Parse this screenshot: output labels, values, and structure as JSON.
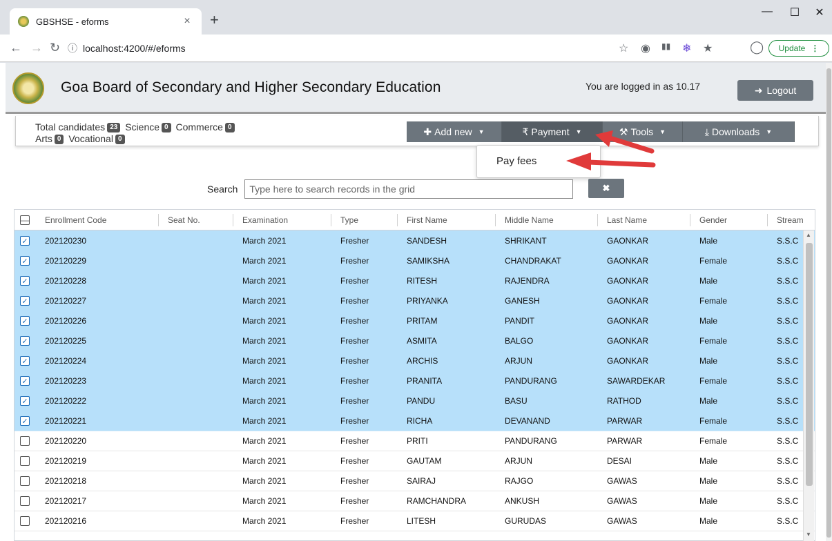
{
  "browser": {
    "tab_title": "GBSHSE - eforms",
    "tab_close": "×",
    "new_tab": "+",
    "url": "localhost:4200/#/eforms",
    "update_label": "Update"
  },
  "header": {
    "title": "Goa Board of Secondary and Higher Secondary Education",
    "logged_in_text": "You are logged in as 10.17",
    "logout_label": "Logout"
  },
  "counts": {
    "total_label": "Total candidates",
    "total": "23",
    "science_label": "Science",
    "science": "0",
    "commerce_label": "Commerce",
    "commerce": "0",
    "arts_label": "Arts",
    "arts": "0",
    "vocational_label": "Vocational",
    "vocational": "0"
  },
  "toolbar": {
    "add_new": "Add new",
    "payment": "Payment",
    "tools": "Tools",
    "downloads": "Downloads"
  },
  "dropdown": {
    "pay_fees": "Pay fees"
  },
  "search": {
    "label": "Search",
    "placeholder": "Type here to search records in the grid",
    "clear": "✖"
  },
  "grid": {
    "columns": [
      "Enrollment Code",
      "Seat No.",
      "Examination",
      "Type",
      "First Name",
      "Middle Name",
      "Last Name",
      "Gender",
      "Stream"
    ],
    "rows": [
      {
        "code": "202120230",
        "seat": "",
        "exam": "March 2021",
        "type": "Fresher",
        "first": "SANDESH",
        "middle": "SHRIKANT",
        "last": "GAONKAR",
        "gender": "Male",
        "stream": "S.S.C",
        "selected": true
      },
      {
        "code": "202120229",
        "seat": "",
        "exam": "March 2021",
        "type": "Fresher",
        "first": "SAMIKSHA",
        "middle": "CHANDRAKAT",
        "last": "GAONKAR",
        "gender": "Female",
        "stream": "S.S.C",
        "selected": true
      },
      {
        "code": "202120228",
        "seat": "",
        "exam": "March 2021",
        "type": "Fresher",
        "first": "RITESH",
        "middle": "RAJENDRA",
        "last": "GAONKAR",
        "gender": "Male",
        "stream": "S.S.C",
        "selected": true
      },
      {
        "code": "202120227",
        "seat": "",
        "exam": "March 2021",
        "type": "Fresher",
        "first": "PRIYANKA",
        "middle": "GANESH",
        "last": "GAONKAR",
        "gender": "Female",
        "stream": "S.S.C",
        "selected": true
      },
      {
        "code": "202120226",
        "seat": "",
        "exam": "March 2021",
        "type": "Fresher",
        "first": "PRITAM",
        "middle": "PANDIT",
        "last": "GAONKAR",
        "gender": "Male",
        "stream": "S.S.C",
        "selected": true
      },
      {
        "code": "202120225",
        "seat": "",
        "exam": "March 2021",
        "type": "Fresher",
        "first": "ASMITA",
        "middle": "BALGO",
        "last": "GAONKAR",
        "gender": "Female",
        "stream": "S.S.C",
        "selected": true
      },
      {
        "code": "202120224",
        "seat": "",
        "exam": "March 2021",
        "type": "Fresher",
        "first": "ARCHIS",
        "middle": "ARJUN",
        "last": "GAONKAR",
        "gender": "Male",
        "stream": "S.S.C",
        "selected": true
      },
      {
        "code": "202120223",
        "seat": "",
        "exam": "March 2021",
        "type": "Fresher",
        "first": "PRANITA",
        "middle": "PANDURANG",
        "last": "SAWARDEKAR",
        "gender": "Female",
        "stream": "S.S.C",
        "selected": true
      },
      {
        "code": "202120222",
        "seat": "",
        "exam": "March 2021",
        "type": "Fresher",
        "first": "PANDU",
        "middle": "BASU",
        "last": "RATHOD",
        "gender": "Male",
        "stream": "S.S.C",
        "selected": true
      },
      {
        "code": "202120221",
        "seat": "",
        "exam": "March 2021",
        "type": "Fresher",
        "first": "RICHA",
        "middle": "DEVANAND",
        "last": "PARWAR",
        "gender": "Female",
        "stream": "S.S.C",
        "selected": true
      },
      {
        "code": "202120220",
        "seat": "",
        "exam": "March 2021",
        "type": "Fresher",
        "first": "PRITI",
        "middle": "PANDURANG",
        "last": "PARWAR",
        "gender": "Female",
        "stream": "S.S.C",
        "selected": false
      },
      {
        "code": "202120219",
        "seat": "",
        "exam": "March 2021",
        "type": "Fresher",
        "first": "GAUTAM",
        "middle": "ARJUN",
        "last": "DESAI",
        "gender": "Male",
        "stream": "S.S.C",
        "selected": false
      },
      {
        "code": "202120218",
        "seat": "",
        "exam": "March 2021",
        "type": "Fresher",
        "first": "SAIRAJ",
        "middle": "RAJGO",
        "last": "GAWAS",
        "gender": "Male",
        "stream": "S.S.C",
        "selected": false
      },
      {
        "code": "202120217",
        "seat": "",
        "exam": "March 2021",
        "type": "Fresher",
        "first": "RAMCHANDRA",
        "middle": "ANKUSH",
        "last": "GAWAS",
        "gender": "Male",
        "stream": "S.S.C",
        "selected": false
      },
      {
        "code": "202120216",
        "seat": "",
        "exam": "March 2021",
        "type": "Fresher",
        "first": "LITESH",
        "middle": "GURUDAS",
        "last": "GAWAS",
        "gender": "Male",
        "stream": "S.S.C",
        "selected": false
      }
    ]
  },
  "colors": {
    "selected_row": "#b7e0fa",
    "button": "#6c757d",
    "arrow": "#e03a3a"
  }
}
